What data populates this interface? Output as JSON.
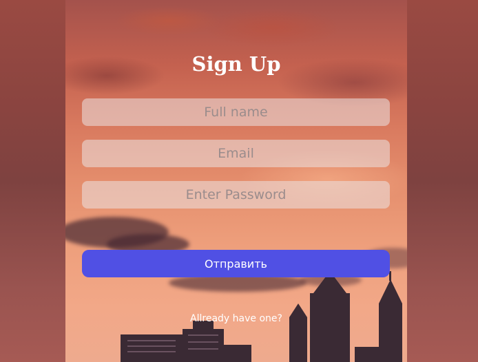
{
  "signup": {
    "title": "Sign Up",
    "fullname_placeholder": "Full name",
    "email_placeholder": "Email",
    "password_placeholder": "Enter Password",
    "submit_label": "Отправить",
    "login_link": "Allready have one?"
  }
}
